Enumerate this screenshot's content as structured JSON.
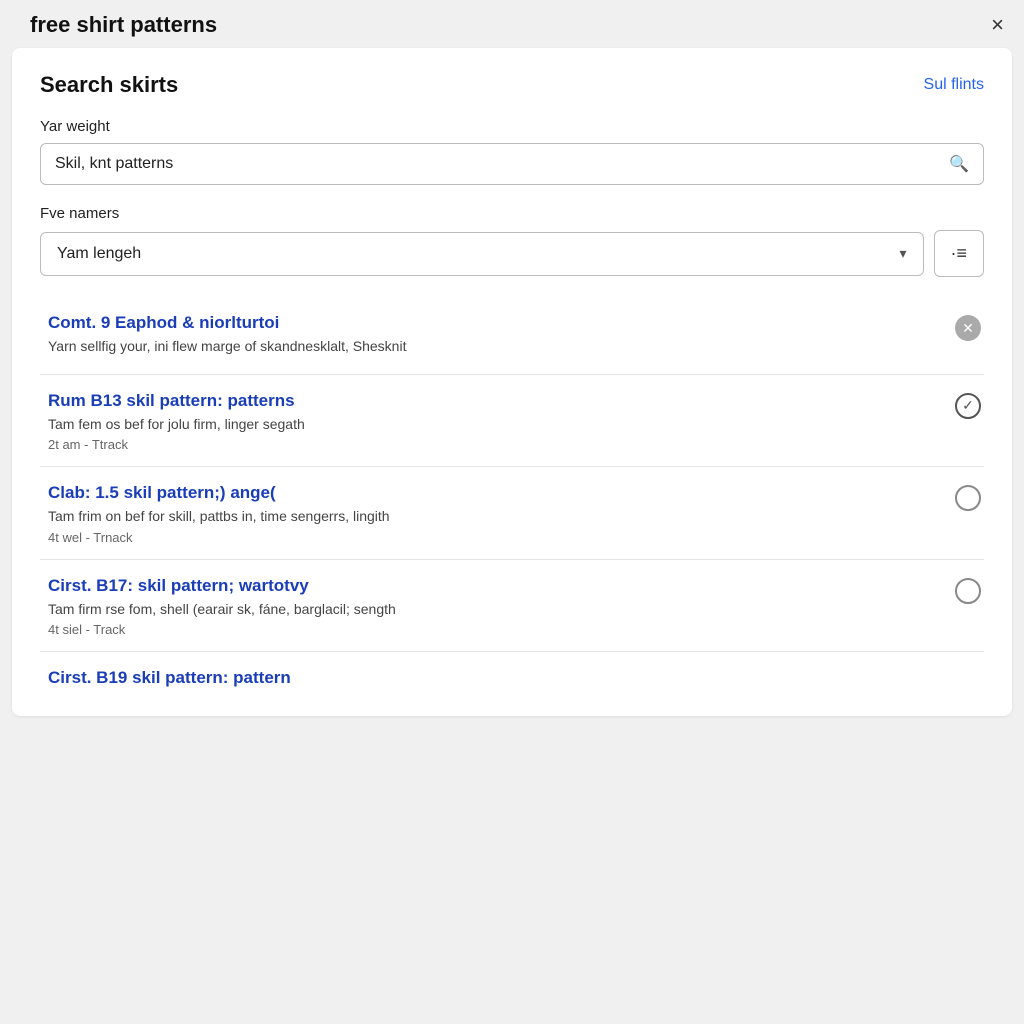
{
  "titleBar": {
    "title": "free shirt patterns",
    "closeLabel": "×"
  },
  "card": {
    "heading": "Search skirts",
    "linkText": "Sul flints",
    "searchSection": {
      "label": "Yar weight",
      "inputValue": "Skil, knt patterns",
      "inputPlaceholder": "Skil, knt patterns"
    },
    "filterSection": {
      "label": "Fve namers",
      "dropdownValue": "Yam lengeh",
      "filterBtnLabel": "·≡"
    },
    "results": [
      {
        "title": "Comt. 9 Eaphod & niorlturtoi",
        "desc": "Yarn sellfig your, ini flew marge of skandnesklalt, Shesknit",
        "meta": "",
        "iconType": "bookmark"
      },
      {
        "title": "Rum B13 skil pattern: patterns",
        "desc": "Tam fem os bef for jolu firm, linger segath",
        "meta": "2t am - Ttrack",
        "iconType": "check"
      },
      {
        "title": "Clab: 1.5 skil pattern;) ange(",
        "desc": "Tam frim on bef for skill, pattbs in, time sengerrs, lingith",
        "meta": "4t wel - Trnack",
        "iconType": "circle"
      },
      {
        "title": "Cirst. B17: skil pattern; wartotvy",
        "desc": "Tam firm rse fom, shell (earair sk, fáne, barglacil; sength",
        "meta": "4t siel - Track",
        "iconType": "circle"
      }
    ],
    "partialResult": {
      "title": "Cirst. B19 skil pattern: pattern"
    }
  }
}
